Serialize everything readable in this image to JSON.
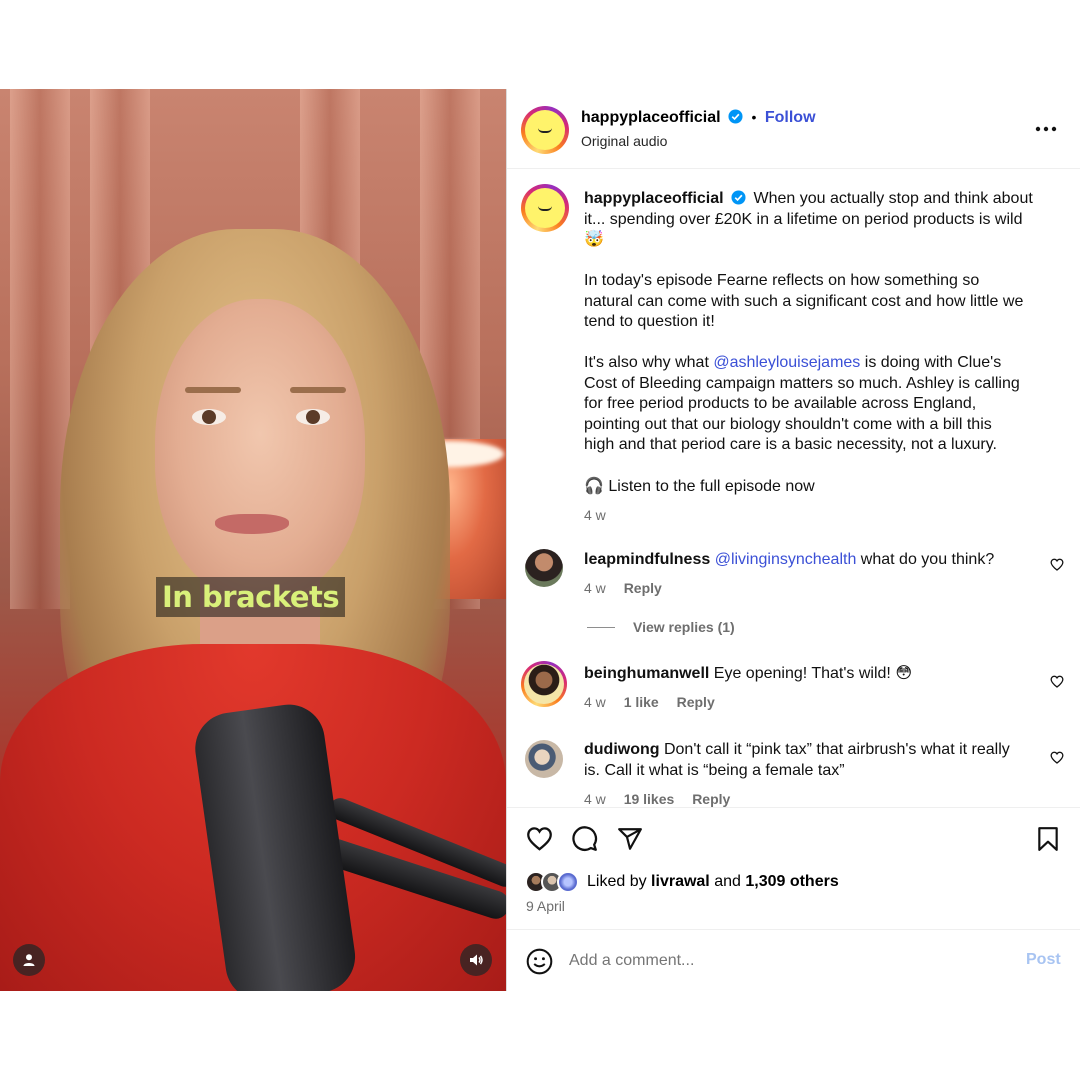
{
  "video": {
    "caption": "In brackets"
  },
  "header": {
    "username": "happyplaceofficial",
    "separator": "•",
    "follow_label": "Follow",
    "audio_label": "Original audio"
  },
  "post": {
    "username": "happyplaceofficial",
    "line1": "When you actually stop and think about",
    "line2": "it... spending over £20K in a lifetime on period products is wild",
    "emoji": "🤯",
    "para2_lines": [
      "In today's episode Fearne reflects on how something so",
      "natural can come with such a significant cost and how little we",
      "tend to question it!"
    ],
    "para3_prefix": "It's also why what ",
    "para3_mention": "@ashleylouisejames",
    "para3_suffix": " is doing with Clue's",
    "para3_lines": [
      "Cost of Bleeding campaign matters so much. Ashley is calling",
      "for free period products to be available across England,",
      "pointing out that our biology shouldn't come with a bill this",
      "high and that period care is a basic necessity, not a luxury."
    ],
    "listen_emoji": "🎧",
    "listen_text": "Listen to the full episode now",
    "time": "4 w"
  },
  "comments": [
    {
      "username": "leapmindfulness",
      "mention": "@livinginsynchealth",
      "text": " what do you think?",
      "time": "4 w",
      "likes": "",
      "reply": "Reply",
      "view_replies": "View replies (1)"
    },
    {
      "username": "beinghumanwell",
      "text": " Eye opening! That's wild! 😳",
      "time": "4 w",
      "likes": "1 like",
      "reply": "Reply"
    },
    {
      "username": "dudiwong",
      "text_line1": " Don't call it “pink tax” that airbrush's what it really",
      "text_line2": "is. Call it what is “being a female tax”",
      "time": "4 w",
      "likes": "19 likes",
      "reply": "Reply"
    }
  ],
  "likes": {
    "prefix": "Liked by ",
    "user": "livrawal",
    "middle": " and ",
    "others": "1,309 others",
    "date": "9 April"
  },
  "composer": {
    "placeholder": "Add a comment...",
    "post_label": "Post"
  },
  "colors": {
    "accent_blue": "#3b50d6",
    "verified_blue": "#0095f6",
    "caption_green": "#d9f07a",
    "post_disabled": "#a8c4f2"
  },
  "icons": [
    "user-icon",
    "speaker-icon",
    "more-options-icon",
    "heart-icon",
    "comment-icon",
    "share-icon",
    "bookmark-icon",
    "emoji-icon",
    "verified-icon"
  ]
}
